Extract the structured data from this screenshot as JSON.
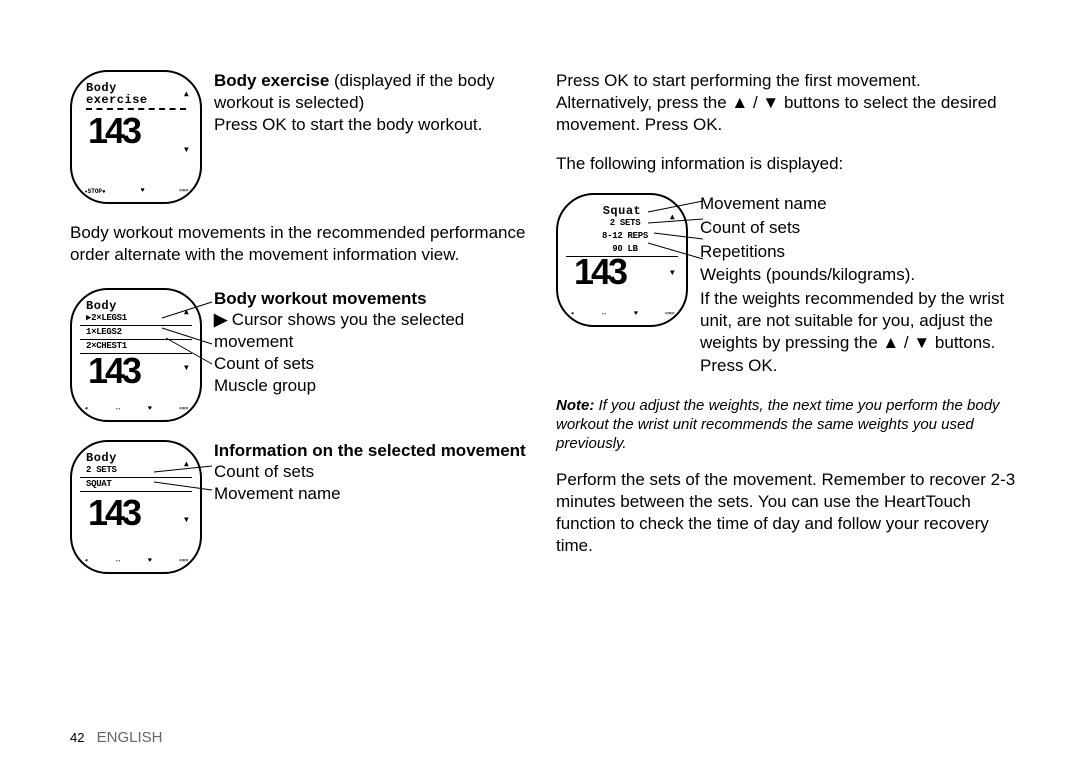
{
  "left": {
    "device1_title1": "Body",
    "device1_title2": "exercise",
    "device_hr": "143",
    "stop_label": "◂STOP●",
    "box_icon": "▭▭",
    "para1_bold": "Body exercise",
    "para1_rest": " (displayed if the body workout is selected)",
    "para1_line2": "Press OK to start the body workout.",
    "para2": "Body workout movements in the recommended performance order alternate with the movement information view.",
    "device2_title": "Body",
    "device2_line1": "▶2×LEGS1",
    "device2_line2": " 1×LEGS2",
    "device2_line3": " 2×CHEST1",
    "sec2_heading": "Body workout movements",
    "sec2_item1_pre": "▶",
    "sec2_item1": " Cursor shows you the selected movement",
    "sec2_item2": "Count of sets",
    "sec2_item3": "Muscle group",
    "device3_title": "Body",
    "device3_line1": "2 SETS",
    "device3_line2": "SQUAT",
    "sec3_heading": "Information on the selected movement",
    "sec3_item1": "Count of sets",
    "sec3_item2": "Movement name"
  },
  "right": {
    "para1a": "Press OK to start performing the first movement.",
    "para1b": "Alternatively, press the ▲ / ▼ buttons to select the desired movement. Press OK.",
    "para2": "The following information is displayed:",
    "device4_title": "Squat",
    "device4_line1": "2 SETS",
    "device4_line2": "8-12 REPS",
    "device4_line3": "90 LB",
    "label1": "Movement name",
    "label2": "Count of sets",
    "label3": "Repetitions",
    "label4": "Weights (pounds/kilograms).",
    "label5": "If the weights recommended by the wrist unit, are not suitable for you, adjust the weights by pressing the ▲ / ▼ buttons.",
    "label6": "Press OK.",
    "note_bold": "Note:",
    "note_rest": " If you adjust the weights, the next time you perform the body workout the wrist unit recommends the same weights you used previously.",
    "para3": "Perform the sets of the movement. Remember to recover 2-3 minutes between the sets. You can use the HeartTouch function to check the time of day and follow your recovery time."
  },
  "footer": {
    "page": "42",
    "lang": "ENGLISH"
  },
  "glyphs": {
    "heart": "♥",
    "arrows_lr": "↔",
    "left_tri": "◂",
    "up_tri": "▴",
    "down_tri": "▾"
  }
}
